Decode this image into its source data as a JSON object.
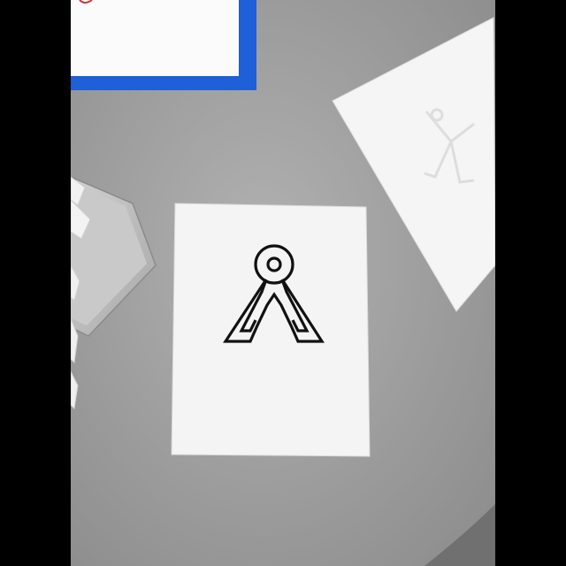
{
  "scene": {
    "description_colors": {
      "table": "#9e9e9e",
      "paper": "#f4f4f4",
      "folder_blue": "#1f5fd8",
      "symbol_stroke": "#111111",
      "laptop": "#c4c4c4"
    },
    "symbol": {
      "name": "stargate-earth-glyph-icon"
    }
  }
}
